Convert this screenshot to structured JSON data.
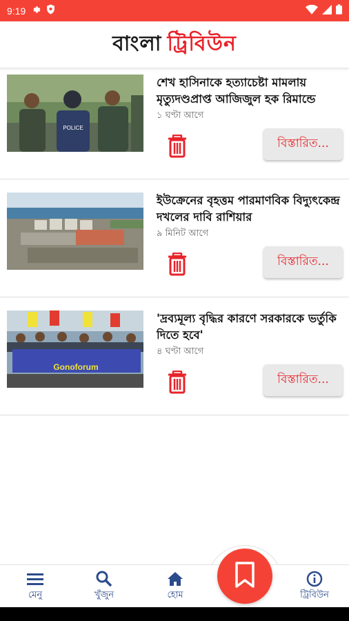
{
  "status_bar": {
    "time": "9:19",
    "icons_left": [
      "gear-icon",
      "shield-icon"
    ],
    "icons_right": [
      "wifi-icon",
      "signal-icon",
      "battery-icon"
    ],
    "color": "#f44336"
  },
  "header": {
    "logo_part1": "বাংলা",
    "logo_part2": "ট্রিবিউন"
  },
  "articles": [
    {
      "title": "শেখ হাসিনাকে হত্যাচেষ্টা মামলায় মৃত্যুদণ্ডপ্রাপ্ত আজিজুল হক রিমান্ডে",
      "time": "১ ঘণ্টা আগে",
      "more_label": "বিস্তারিত...",
      "image": "police-escort-photo"
    },
    {
      "title": "ইউক্রেনের বৃহত্তম পারমাণবিক বিদ্যুৎকেন্দ্র দখলের দাবি রাশিয়ার",
      "time": "৯ মিনিট আগে",
      "more_label": "বিস্তারিত...",
      "image": "nuclear-plant-photo"
    },
    {
      "title": "'দ্রব্যমূল্য বৃদ্ধির কারণে সরকারকে ভর্তুকি দিতে হবে'",
      "time": "৪ ঘণ্টা আগে",
      "more_label": "বিস্তারিত...",
      "image": "protest-rally-photo",
      "banner_text": "Gonoforum"
    }
  ],
  "bottom_nav": {
    "menu": "মেনু",
    "search": "খুঁজুন",
    "home": "হোম",
    "about": "ট্রিবিউন"
  },
  "colors": {
    "accent": "#e8232a",
    "nav_text": "#2b4b8c",
    "fab": "#f44336"
  }
}
